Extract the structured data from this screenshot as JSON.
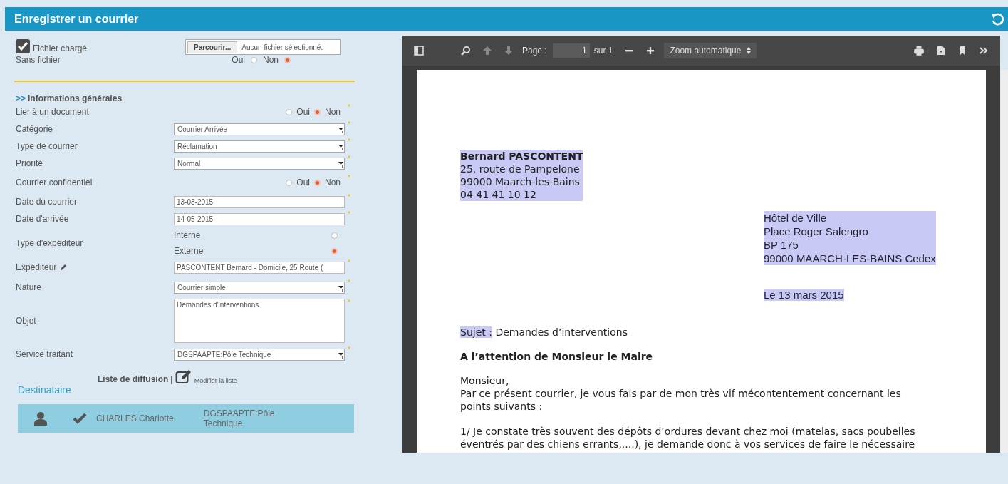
{
  "header": {
    "title": "Enregistrer un courrier"
  },
  "file": {
    "loaded_label": "Fichier chargé",
    "loaded_checked": true,
    "browse_button": "Parcourir...",
    "file_status": "Aucun fichier sélectionné.",
    "no_file_label": "Sans fichier",
    "no_file_options": [
      {
        "label": "Oui",
        "selected": false
      },
      {
        "label": "Non",
        "selected": true
      }
    ]
  },
  "section": {
    "marker": ">>",
    "title": "Informations générales"
  },
  "required_mark": "*",
  "fields": [
    {
      "kind": "radio",
      "label": "Lier à un document",
      "required": true,
      "options": [
        {
          "label": "Oui",
          "selected": false
        },
        {
          "label": "Non",
          "selected": true
        }
      ]
    },
    {
      "kind": "select",
      "label": "Catégorie",
      "value": "Courrier Arrivée",
      "required": true
    },
    {
      "kind": "select",
      "label": "Type de courrier",
      "value": "Réclamation",
      "required": true
    },
    {
      "kind": "select",
      "label": "Priorité",
      "value": "Normal",
      "required": true
    },
    {
      "kind": "radio",
      "label": "Courrier confidentiel",
      "required": true,
      "options": [
        {
          "label": "Oui",
          "selected": false
        },
        {
          "label": "Non",
          "selected": true
        }
      ]
    },
    {
      "kind": "text",
      "label": "Date du courrier",
      "value": "13-03-2015",
      "required": true
    },
    {
      "kind": "text",
      "label": "Date d'arrivée",
      "value": "14-05-2015",
      "required": true
    },
    {
      "kind": "radio_list",
      "label": "Type d'expéditeur",
      "required": false,
      "options": [
        {
          "label": "Interne",
          "selected": false
        },
        {
          "label": "Externe",
          "selected": true
        }
      ]
    },
    {
      "kind": "lookup",
      "label": "Expéditeur",
      "value": "PASCONTENT Bernard - Domicile, 25 Route (",
      "required": true
    },
    {
      "kind": "select",
      "label": "Nature",
      "value": "Courrier simple",
      "required": true
    },
    {
      "kind": "textarea",
      "label": "Objet",
      "value": "Demandes d'interventions",
      "required": true
    },
    {
      "kind": "select",
      "label": "Service traitant",
      "value": "DGSPAAPTE:Pôle Technique",
      "required": true
    }
  ],
  "diffusion": {
    "title": "Liste de diffusion",
    "separator": "|",
    "edit_link": "Modifier la liste"
  },
  "recipients": {
    "title": "Destinataire",
    "rows": [
      {
        "name": "CHARLES Charlotte",
        "service": "DGSPAAPTE:Pôle Technique"
      }
    ]
  },
  "viewer": {
    "page_label": "Page :",
    "page_value": "1",
    "page_total": "sur 1",
    "zoom": "Zoom automatique",
    "document": {
      "sender": {
        "highlighted": true,
        "name": "Bernard PASCONTENT",
        "lines": [
          "25, route de Pampelone",
          "99000 Maarch-les-Bains",
          "04 41 41 10 12"
        ]
      },
      "recipient": {
        "highlighted": true,
        "lines": [
          "Hôtel de Ville",
          "Place Roger Salengro",
          "BP 175",
          "99000 MAARCH-LES-BAINS Cedex"
        ]
      },
      "date": {
        "highlighted": true,
        "text": "Le 13 mars 2015"
      },
      "subject": {
        "label": "Sujet :",
        "label_highlighted": true,
        "text": "Demandes d’interventions"
      },
      "attention": "A l’attention de Monsieur le Maire",
      "paragraphs": [
        {
          "lines": [
            "Monsieur,",
            "Par ce présent courrier, je vous fais par de mon très vif mécontentement concernant les",
            "points suivants :"
          ]
        },
        {
          "lines": [
            "1/ Je constate très souvent des dépôts d’ordures devant chez moi (matelas, sacs poubelles",
            "éventrés par des chiens errants,....), je demande donc à vos services de faire le nécessaire"
          ]
        }
      ]
    }
  }
}
